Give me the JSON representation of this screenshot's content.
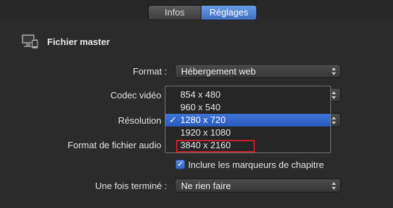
{
  "tabs": [
    {
      "label": "Infos"
    },
    {
      "label": "Réglages"
    }
  ],
  "section": {
    "title": "Fichier master",
    "icon": "monitor-device-icon"
  },
  "fields": {
    "format": {
      "label": "Format :",
      "value": "Hébergement web"
    },
    "codec": {
      "label": "Codec vidéo"
    },
    "resolution": {
      "label": "Résolution"
    },
    "file_format": {
      "label": "Format de fichier audio"
    },
    "when_done": {
      "label": "Une fois terminé :",
      "value": "Ne rien faire"
    }
  },
  "resolution_menu": {
    "options": [
      "854 x 480",
      "960 x 540",
      "1280 x 720",
      "1920 x 1080",
      "3840 x 2160"
    ],
    "selected": "1280 x 720",
    "highlighted": "3840 x 2160"
  },
  "chapter_markers": {
    "label": "Inclure les marqueurs de chapitre",
    "checked": true
  },
  "colors": {
    "accent": "#3f73d6",
    "highlight_border": "#c2202a"
  }
}
